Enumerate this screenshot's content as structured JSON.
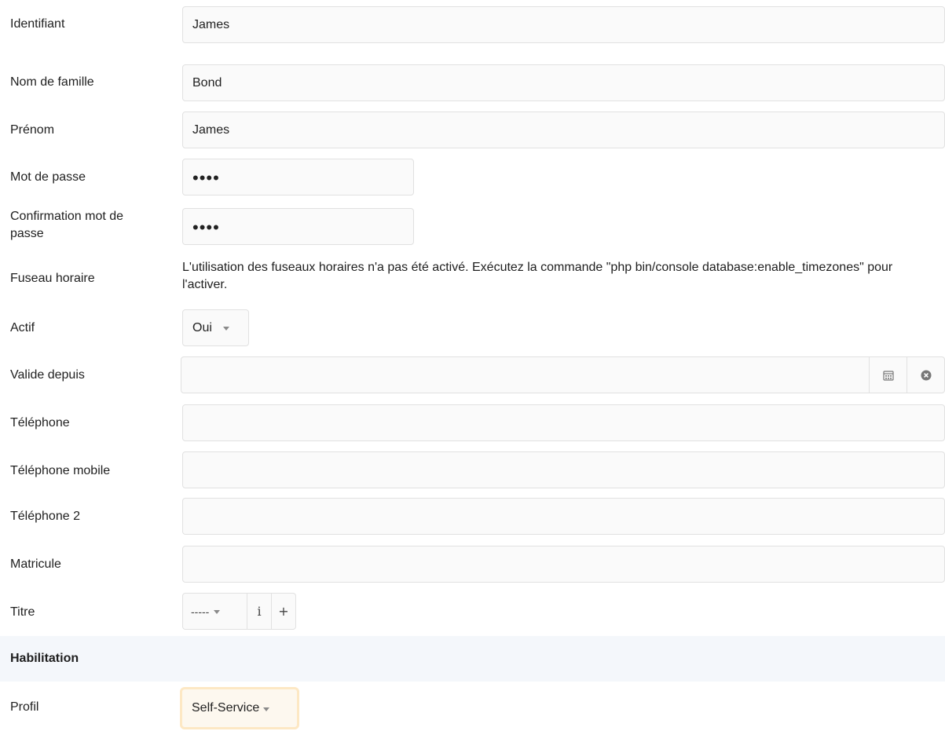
{
  "fields": {
    "identifiant": {
      "label": "Identifiant",
      "value": "James"
    },
    "nom": {
      "label": "Nom de famille",
      "value": "Bond"
    },
    "prenom": {
      "label": "Prénom",
      "value": "James"
    },
    "password": {
      "label": "Mot de passe",
      "value": "••••"
    },
    "password_confirm": {
      "label_line1": "Confirmation mot de",
      "label_line2": "passe",
      "value": "••••"
    },
    "timezone": {
      "label": "Fuseau horaire",
      "note": "L'utilisation des fuseaux horaires n'a pas été activé. Exécutez la commande \"php bin/console database:enable_timezones\" pour l'activer."
    },
    "actif": {
      "label": "Actif",
      "value": "Oui"
    },
    "valide_depuis": {
      "label": "Valide depuis",
      "value": ""
    },
    "telephone": {
      "label": "Téléphone",
      "value": ""
    },
    "telephone_mobile": {
      "label": "Téléphone mobile",
      "value": ""
    },
    "telephone2": {
      "label": "Téléphone 2",
      "value": ""
    },
    "matricule": {
      "label": "Matricule",
      "value": ""
    },
    "titre": {
      "label": "Titre",
      "value": "-----",
      "info_label": "i",
      "add_label": "+"
    }
  },
  "habilitation": {
    "heading": "Habilitation",
    "profil": {
      "label": "Profil",
      "value": "Self-Service"
    }
  },
  "icons": {
    "calendar": "calendar-icon",
    "clear": "close-circle-icon",
    "caret": "caret-down-icon"
  },
  "colors": {
    "section_bg": "#f4f7fb",
    "focus_border": "#fde8c4"
  }
}
